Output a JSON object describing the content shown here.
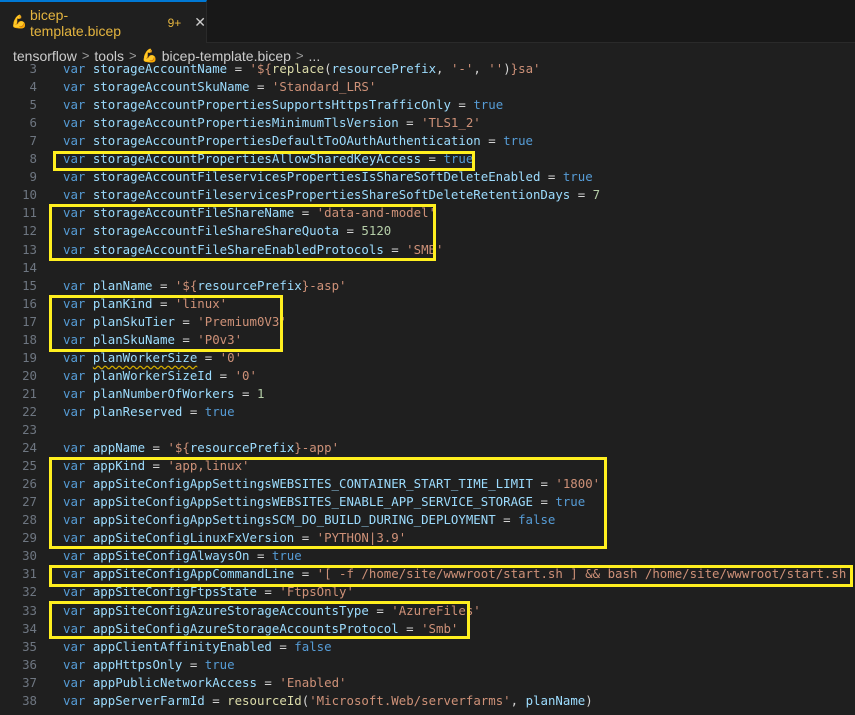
{
  "tab": {
    "filename": "bicep-template.bicep",
    "badge": "9+",
    "close_glyph": "✕",
    "file_icon": "bicep-file-icon"
  },
  "breadcrumb": {
    "items": [
      "tensorflow",
      "tools",
      "bicep-template.bicep",
      "..."
    ],
    "separator": ">"
  },
  "colors": {
    "keyword": "#569cd6",
    "variable": "#9cdcfe",
    "string": "#ce9178",
    "number": "#b5cea8",
    "highlight_box": "#ffef1f",
    "tab_text": "#e5b53f"
  },
  "code": {
    "lines": [
      {
        "n": 3,
        "t": [
          [
            "kw",
            "var "
          ],
          [
            "id",
            "storageAccountName"
          ],
          [
            "op",
            " = "
          ],
          [
            "str",
            "'${"
          ],
          [
            "fn",
            "replace"
          ],
          [
            "op",
            "("
          ],
          [
            "id",
            "resourcePrefix"
          ],
          [
            "op",
            ", "
          ],
          [
            "str",
            "'-'"
          ],
          [
            "op",
            ", "
          ],
          [
            "str",
            "''"
          ],
          [
            "op",
            ")"
          ],
          [
            "str",
            "}sa'"
          ]
        ]
      },
      {
        "n": 4,
        "t": [
          [
            "kw",
            "var "
          ],
          [
            "id",
            "storageAccountSkuName"
          ],
          [
            "op",
            " = "
          ],
          [
            "str",
            "'Standard_LRS'"
          ]
        ]
      },
      {
        "n": 5,
        "t": [
          [
            "kw",
            "var "
          ],
          [
            "id",
            "storageAccountPropertiesSupportsHttpsTrafficOnly"
          ],
          [
            "op",
            " = "
          ],
          [
            "kw",
            "true"
          ]
        ]
      },
      {
        "n": 6,
        "t": [
          [
            "kw",
            "var "
          ],
          [
            "id",
            "storageAccountPropertiesMinimumTlsVersion"
          ],
          [
            "op",
            " = "
          ],
          [
            "str",
            "'TLS1_2'"
          ]
        ]
      },
      {
        "n": 7,
        "t": [
          [
            "kw",
            "var "
          ],
          [
            "id",
            "storageAccountPropertiesDefaultToOAuthAuthentication"
          ],
          [
            "op",
            " = "
          ],
          [
            "kw",
            "true"
          ]
        ]
      },
      {
        "n": 8,
        "t": [
          [
            "kw",
            "var "
          ],
          [
            "id",
            "storageAccountPropertiesAllowSharedKeyAccess"
          ],
          [
            "op",
            " = "
          ],
          [
            "kw",
            "true"
          ]
        ]
      },
      {
        "n": 9,
        "t": [
          [
            "kw",
            "var "
          ],
          [
            "id",
            "storageAccountFileservicesPropertiesIsShareSoftDeleteEnabled"
          ],
          [
            "op",
            " = "
          ],
          [
            "kw",
            "true"
          ]
        ]
      },
      {
        "n": 10,
        "t": [
          [
            "kw",
            "var "
          ],
          [
            "id",
            "storageAccountFileservicesPropertiesShareSoftDeleteRetentionDays"
          ],
          [
            "op",
            " = "
          ],
          [
            "num",
            "7"
          ]
        ]
      },
      {
        "n": 11,
        "t": [
          [
            "kw",
            "var "
          ],
          [
            "id",
            "storageAccountFileShareName"
          ],
          [
            "op",
            " = "
          ],
          [
            "str",
            "'data-and-model'"
          ]
        ]
      },
      {
        "n": 12,
        "t": [
          [
            "kw",
            "var "
          ],
          [
            "id",
            "storageAccountFileShareShareQuota"
          ],
          [
            "op",
            " = "
          ],
          [
            "num",
            "5120"
          ]
        ]
      },
      {
        "n": 13,
        "t": [
          [
            "kw",
            "var "
          ],
          [
            "id",
            "storageAccountFileShareEnabledProtocols"
          ],
          [
            "op",
            " = "
          ],
          [
            "str",
            "'SMB'"
          ]
        ]
      },
      {
        "n": 14,
        "t": []
      },
      {
        "n": 15,
        "t": [
          [
            "kw",
            "var "
          ],
          [
            "id",
            "planName"
          ],
          [
            "op",
            " = "
          ],
          [
            "str",
            "'${"
          ],
          [
            "id",
            "resourcePrefix"
          ],
          [
            "str",
            "}-asp'"
          ]
        ]
      },
      {
        "n": 16,
        "t": [
          [
            "kw",
            "var "
          ],
          [
            "id",
            "planKind"
          ],
          [
            "op",
            " = "
          ],
          [
            "str",
            "'linux'"
          ]
        ]
      },
      {
        "n": 17,
        "t": [
          [
            "kw",
            "var "
          ],
          [
            "id",
            "planSkuTier"
          ],
          [
            "op",
            " = "
          ],
          [
            "str",
            "'Premium0V3'"
          ]
        ]
      },
      {
        "n": 18,
        "t": [
          [
            "kw",
            "var "
          ],
          [
            "id",
            "planSkuName"
          ],
          [
            "op",
            " = "
          ],
          [
            "str",
            "'P0v3'"
          ]
        ]
      },
      {
        "n": 19,
        "t": [
          [
            "kw",
            "var "
          ],
          [
            "sq",
            "planWorkerSize"
          ],
          [
            "op",
            " = "
          ],
          [
            "str",
            "'0'"
          ]
        ]
      },
      {
        "n": 20,
        "t": [
          [
            "kw",
            "var "
          ],
          [
            "id",
            "planWorkerSizeId"
          ],
          [
            "op",
            " = "
          ],
          [
            "str",
            "'0'"
          ]
        ]
      },
      {
        "n": 21,
        "t": [
          [
            "kw",
            "var "
          ],
          [
            "id",
            "planNumberOfWorkers"
          ],
          [
            "op",
            " = "
          ],
          [
            "num",
            "1"
          ]
        ]
      },
      {
        "n": 22,
        "t": [
          [
            "kw",
            "var "
          ],
          [
            "id",
            "planReserved"
          ],
          [
            "op",
            " = "
          ],
          [
            "kw",
            "true"
          ]
        ]
      },
      {
        "n": 23,
        "t": []
      },
      {
        "n": 24,
        "t": [
          [
            "kw",
            "var "
          ],
          [
            "id",
            "appName"
          ],
          [
            "op",
            " = "
          ],
          [
            "str",
            "'${"
          ],
          [
            "id",
            "resourcePrefix"
          ],
          [
            "str",
            "}-app'"
          ]
        ]
      },
      {
        "n": 25,
        "t": [
          [
            "kw",
            "var "
          ],
          [
            "id",
            "appKind"
          ],
          [
            "op",
            " = "
          ],
          [
            "str",
            "'app,linux'"
          ]
        ]
      },
      {
        "n": 26,
        "t": [
          [
            "kw",
            "var "
          ],
          [
            "id",
            "appSiteConfigAppSettingsWEBSITES_CONTAINER_START_TIME_LIMIT"
          ],
          [
            "op",
            " = "
          ],
          [
            "str",
            "'1800'"
          ]
        ]
      },
      {
        "n": 27,
        "t": [
          [
            "kw",
            "var "
          ],
          [
            "id",
            "appSiteConfigAppSettingsWEBSITES_ENABLE_APP_SERVICE_STORAGE"
          ],
          [
            "op",
            " = "
          ],
          [
            "kw",
            "true"
          ]
        ]
      },
      {
        "n": 28,
        "t": [
          [
            "kw",
            "var "
          ],
          [
            "id",
            "appSiteConfigAppSettingsSCM_DO_BUILD_DURING_DEPLOYMENT"
          ],
          [
            "op",
            " = "
          ],
          [
            "kw",
            "false"
          ]
        ]
      },
      {
        "n": 29,
        "t": [
          [
            "kw",
            "var "
          ],
          [
            "id",
            "appSiteConfigLinuxFxVersion"
          ],
          [
            "op",
            " = "
          ],
          [
            "str",
            "'PYTHON|3.9'"
          ]
        ]
      },
      {
        "n": 30,
        "t": [
          [
            "kw",
            "var "
          ],
          [
            "id",
            "appSiteConfigAlwaysOn"
          ],
          [
            "op",
            " = "
          ],
          [
            "kw",
            "true"
          ]
        ]
      },
      {
        "n": 31,
        "t": [
          [
            "kw",
            "var "
          ],
          [
            "id",
            "appSiteConfigAppCommandLine"
          ],
          [
            "op",
            " = "
          ],
          [
            "str",
            "'[ -f /home/site/wwwroot/start.sh ] && bash /home/site/wwwroot/start.sh ||"
          ]
        ]
      },
      {
        "n": 32,
        "t": [
          [
            "kw",
            "var "
          ],
          [
            "id",
            "appSiteConfigFtpsState"
          ],
          [
            "op",
            " = "
          ],
          [
            "str",
            "'FtpsOnly'"
          ]
        ]
      },
      {
        "n": 33,
        "t": [
          [
            "kw",
            "var "
          ],
          [
            "id",
            "appSiteConfigAzureStorageAccountsType"
          ],
          [
            "op",
            " = "
          ],
          [
            "str",
            "'AzureFiles'"
          ]
        ]
      },
      {
        "n": 34,
        "t": [
          [
            "kw",
            "var "
          ],
          [
            "id",
            "appSiteConfigAzureStorageAccountsProtocol"
          ],
          [
            "op",
            " = "
          ],
          [
            "str",
            "'Smb'"
          ]
        ]
      },
      {
        "n": 35,
        "t": [
          [
            "kw",
            "var "
          ],
          [
            "id",
            "appClientAffinityEnabled"
          ],
          [
            "op",
            " = "
          ],
          [
            "kw",
            "false"
          ]
        ]
      },
      {
        "n": 36,
        "t": [
          [
            "kw",
            "var "
          ],
          [
            "id",
            "appHttpsOnly"
          ],
          [
            "op",
            " = "
          ],
          [
            "kw",
            "true"
          ]
        ]
      },
      {
        "n": 37,
        "t": [
          [
            "kw",
            "var "
          ],
          [
            "id",
            "appPublicNetworkAccess"
          ],
          [
            "op",
            " = "
          ],
          [
            "str",
            "'Enabled'"
          ]
        ]
      },
      {
        "n": 38,
        "t": [
          [
            "kw",
            "var "
          ],
          [
            "id",
            "appServerFarmId"
          ],
          [
            "op",
            " = "
          ],
          [
            "fn",
            "resourceId"
          ],
          [
            "op",
            "("
          ],
          [
            "str",
            "'Microsoft.Web/serverfarms'"
          ],
          [
            "op",
            ", "
          ],
          [
            "id",
            "planName"
          ],
          [
            "op",
            ")"
          ]
        ]
      }
    ]
  }
}
